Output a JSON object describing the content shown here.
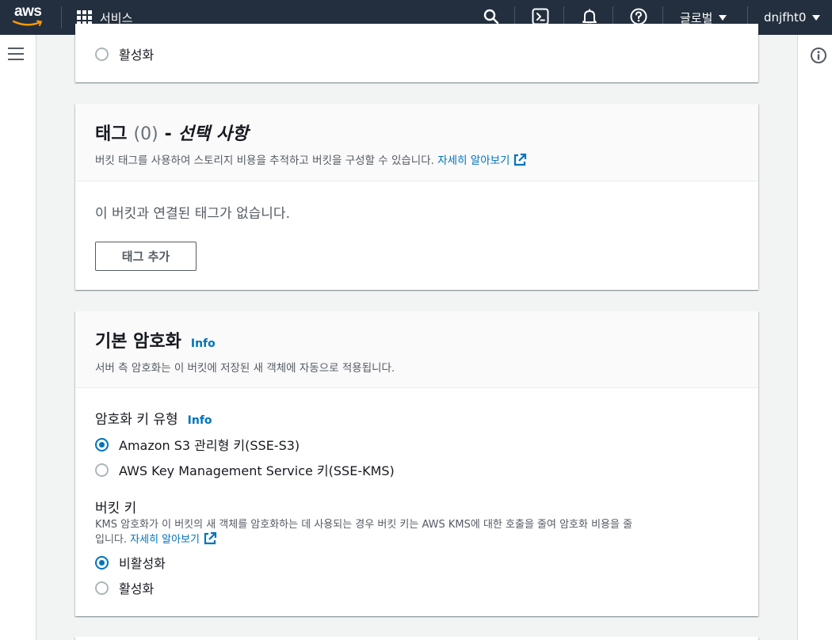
{
  "topnav": {
    "logo_text": "aws",
    "services_label": "서비스",
    "icons": [
      "search-icon",
      "cloudshell-icon",
      "bell-icon",
      "help-icon"
    ],
    "region_label": "글로벌",
    "account_label": "dnjfht0"
  },
  "bucket_versioning_partial": {
    "radio_enable_label": "활성화"
  },
  "tags": {
    "title": "태그",
    "count": "(0)",
    "dash": "-",
    "optional": "선택 사항",
    "description": "버킷 태그를 사용하여 스토리지 비용을 추적하고 버킷을 구성할 수 있습니다.",
    "learn_more": "자세히 알아보기",
    "empty_text": "이 버킷과 연결된 태그가 없습니다.",
    "add_button": "태그 추가"
  },
  "default_encryption": {
    "title": "기본 암호화",
    "info": "Info",
    "description": "서버 측 암호화는 이 버킷에 저장된 새 객체에 자동으로 적용됩니다.",
    "key_type_label": "암호화 키 유형",
    "key_type_info": "Info",
    "key_type_options": [
      {
        "label": "Amazon S3 관리형 키(SSE-S3)",
        "checked": true
      },
      {
        "label": "AWS Key Management Service 키(SSE-KMS)",
        "checked": false
      }
    ],
    "bucket_key_label": "버킷 키",
    "bucket_key_desc_line1": "KMS 암호화가 이 버킷의 새 객체를 암호화하는 데 사용되는 경우 버킷 키는 AWS KMS에 대한 호출을 줄여 암호화 비용을 줄",
    "bucket_key_desc_line2": "입니다.",
    "learn_more": "자세히 알아보기",
    "bucket_key_options": [
      {
        "label": "비활성화",
        "checked": true
      },
      {
        "label": "활성화",
        "checked": false
      }
    ]
  },
  "colors": {
    "nav_bg": "#232f3e",
    "page_bg": "#f2f3f3",
    "link": "#0073bb",
    "aws_orange": "#ff9900"
  }
}
